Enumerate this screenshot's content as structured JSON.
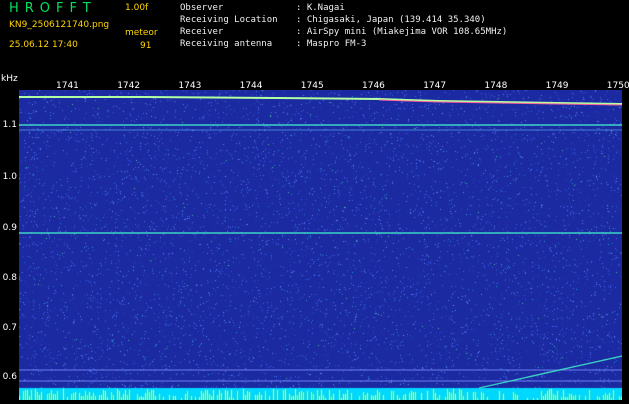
{
  "header": {
    "app_title": "HROFFT",
    "version": "1.00f",
    "filename": "KN9_2506121740.png",
    "datetime": "25.06.12 17:40",
    "meteor_label": "meteor",
    "meteor_count": "91"
  },
  "station": {
    "observer_label": "Observer",
    "observer_value": ": K.Nagai",
    "location_label": "Receiving Location",
    "location_value": ": Chigasaki, Japan (139.414 35.340)",
    "receiver_label": "Receiver",
    "receiver_value": ": AirSpy mini (Miakejima VOR 108.65MHz)",
    "antenna_label": "Receiving antenna",
    "antenna_value": ": Maspro FM-3"
  },
  "axis": {
    "unit": "kHz",
    "y_ticks": [
      "1.1",
      "1.0",
      "0.9",
      "0.8",
      "0.7",
      "0.6"
    ],
    "x_ticks": [
      "1741",
      "1742",
      "1743",
      "1744",
      "1745",
      "1746",
      "1747",
      "1748",
      "1749",
      "1750"
    ]
  },
  "colors": {
    "background": "#1b2aa0",
    "noise": "#4a68ff",
    "line": "#40e8c8",
    "bottom_band": "#00d8ff"
  }
}
